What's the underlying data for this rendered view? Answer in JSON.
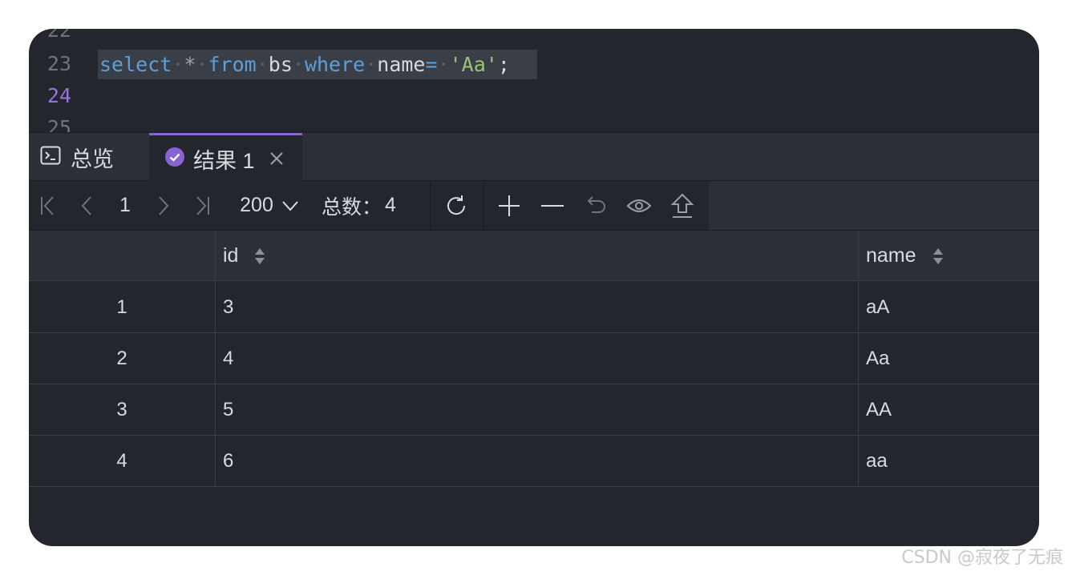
{
  "editor": {
    "lines": [
      {
        "num": "22"
      },
      {
        "num": "23"
      },
      {
        "num": "24"
      },
      {
        "num": "25"
      }
    ],
    "sql": {
      "kw_select": "select",
      "star": "*",
      "kw_from": "from",
      "table": "bs",
      "kw_where": "where",
      "column": "name",
      "eq": "=",
      "string": "'Aa'",
      "semi": ";"
    }
  },
  "tabs": {
    "overview_label": "总览",
    "result_label": "结果 1"
  },
  "toolbar": {
    "page": "1",
    "page_size": "200",
    "total_label": "总数：",
    "total_value": "4"
  },
  "icons": {
    "first": "first-page-icon",
    "prev": "prev-page-icon",
    "next": "next-page-icon",
    "last": "last-page-icon",
    "refresh": "refresh-icon",
    "add": "add-row-icon",
    "remove": "remove-row-icon",
    "undo": "undo-icon",
    "view": "eye-icon",
    "export": "export-icon"
  },
  "colors": {
    "accent": "#8a63d2",
    "keyword": "#5f9ed8",
    "string": "#98c379",
    "background": "#23262c"
  },
  "table": {
    "columns": [
      "id",
      "name"
    ],
    "rows": [
      {
        "rownum": "1",
        "id": "3",
        "name": "aA"
      },
      {
        "rownum": "2",
        "id": "4",
        "name": "Aa"
      },
      {
        "rownum": "3",
        "id": "5",
        "name": "AA"
      },
      {
        "rownum": "4",
        "id": "6",
        "name": "aa"
      }
    ]
  },
  "watermark": "CSDN @寂夜了无痕"
}
